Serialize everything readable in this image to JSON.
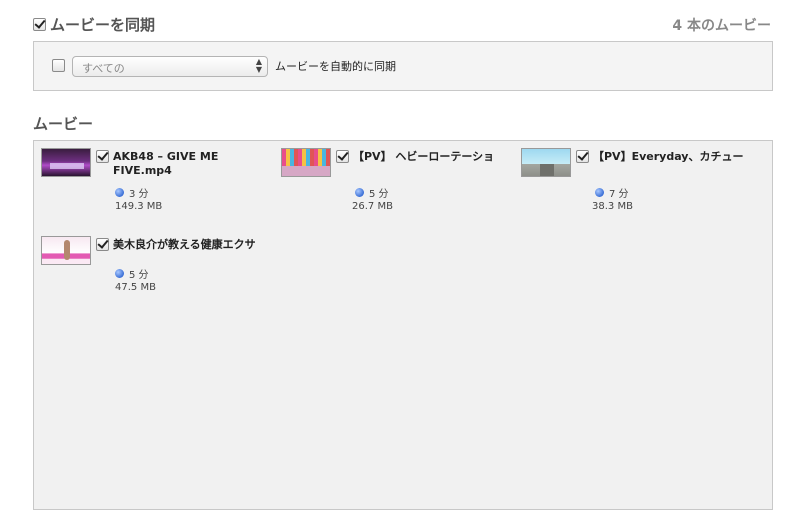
{
  "sync": {
    "title": "ムービーを同期",
    "checked": true,
    "movie_count": "4 本のムービー"
  },
  "options": {
    "auto_sync_checked": false,
    "select_value": "すべての",
    "auto_sync_label": "ムービーを自動的に同期"
  },
  "movies_section": {
    "title": "ムービー"
  },
  "movies": [
    {
      "title": "AKB48 – GIVE ME FIVE.mp4",
      "duration": "3 分",
      "size": "149.3 MB",
      "checked": true,
      "thumbnail_icon": "concert-thumbnail"
    },
    {
      "title": "【PV】 ヘビーローテーショ",
      "duration": "5 分",
      "size": "26.7 MB",
      "checked": true,
      "thumbnail_icon": "dance-thumbnail"
    },
    {
      "title": "【PV】Everyday、カチュー",
      "duration": "7 分",
      "size": "38.3 MB",
      "checked": true,
      "thumbnail_icon": "road-thumbnail"
    },
    {
      "title": "美木良介が教える健康エクサ",
      "duration": "5 分",
      "size": "47.5 MB",
      "checked": true,
      "thumbnail_icon": "exercise-thumbnail"
    }
  ]
}
